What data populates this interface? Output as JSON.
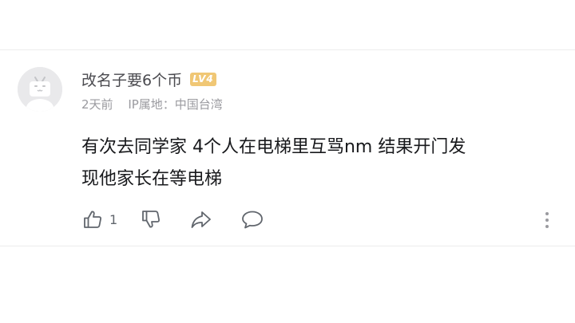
{
  "comment": {
    "username": "改名子要6个币",
    "level_badge": "LV4",
    "time": "2天前",
    "ip_location": "IP属地：中国台湾",
    "text_line1": "有次去同学家 4个人在电梯里互骂nm 结果开门发",
    "text_line2": "现他家长在等电梯",
    "like_count": "1"
  },
  "icons": {
    "avatar": "default-tv-avatar-icon",
    "like": "thumbs-up-icon",
    "dislike": "thumbs-down-icon",
    "share": "share-arrow-icon",
    "reply": "speech-bubble-icon",
    "more": "vertical-ellipsis-icon"
  },
  "colors": {
    "level_badge": "#f0c775",
    "text": "#18191c",
    "meta": "#9a9a9f"
  }
}
